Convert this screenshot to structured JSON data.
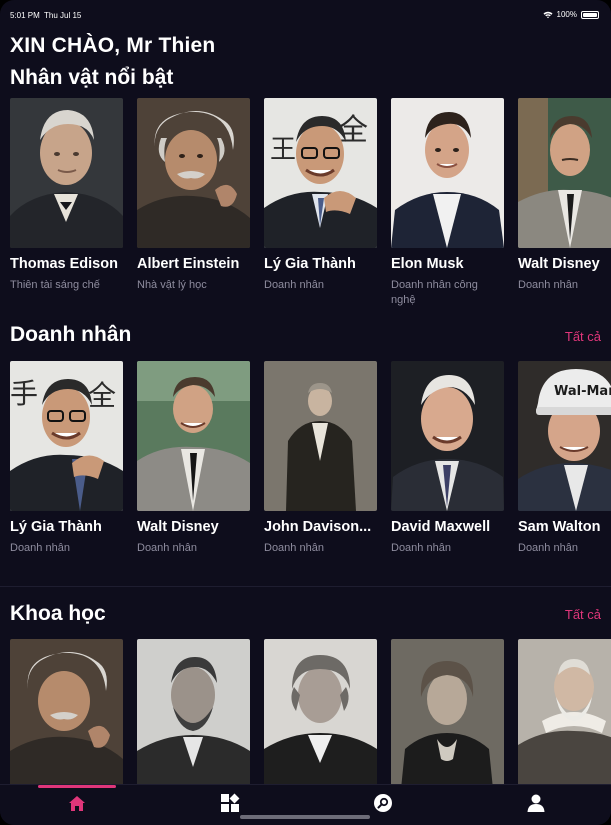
{
  "status_bar": {
    "time": "5:01 PM",
    "date": "Thu Jul 15",
    "battery": "100%"
  },
  "greeting": "XIN CHÀO, Mr Thien",
  "featured": {
    "title": "Nhân vật nổi bật",
    "items": [
      {
        "name": "Thomas Edison",
        "role": "Thiên tài sáng chế"
      },
      {
        "name": "Albert Einstein",
        "role": "Nhà vật lý học"
      },
      {
        "name": "Lý Gia Thành",
        "role": "Doanh nhân"
      },
      {
        "name": "Elon Musk",
        "role": "Doanh nhân công nghệ"
      },
      {
        "name": "Walt Disney",
        "role": "Doanh nhân"
      }
    ]
  },
  "business": {
    "title": "Doanh nhân",
    "see_all": "Tất cả",
    "items": [
      {
        "name": "Lý Gia Thành",
        "role": "Doanh nhân"
      },
      {
        "name": "Walt Disney",
        "role": "Doanh nhân"
      },
      {
        "name": "John Davison...",
        "role": "Doanh nhân"
      },
      {
        "name": "David Maxwell",
        "role": "Doanh nhân"
      },
      {
        "name": "Sam Walton",
        "role": "Doanh nhân"
      }
    ]
  },
  "science": {
    "title": "Khoa học",
    "see_all": "Tất cả"
  },
  "tab_bar": {
    "tabs": [
      "home-icon",
      "categories-icon",
      "search-icon",
      "profile-icon"
    ],
    "active_color": "#e0367a",
    "inactive_color": "#ffffff"
  },
  "colors": {
    "background": "#0e0d1c",
    "accent": "#e0367a",
    "subtitle": "#8e8c9e"
  }
}
